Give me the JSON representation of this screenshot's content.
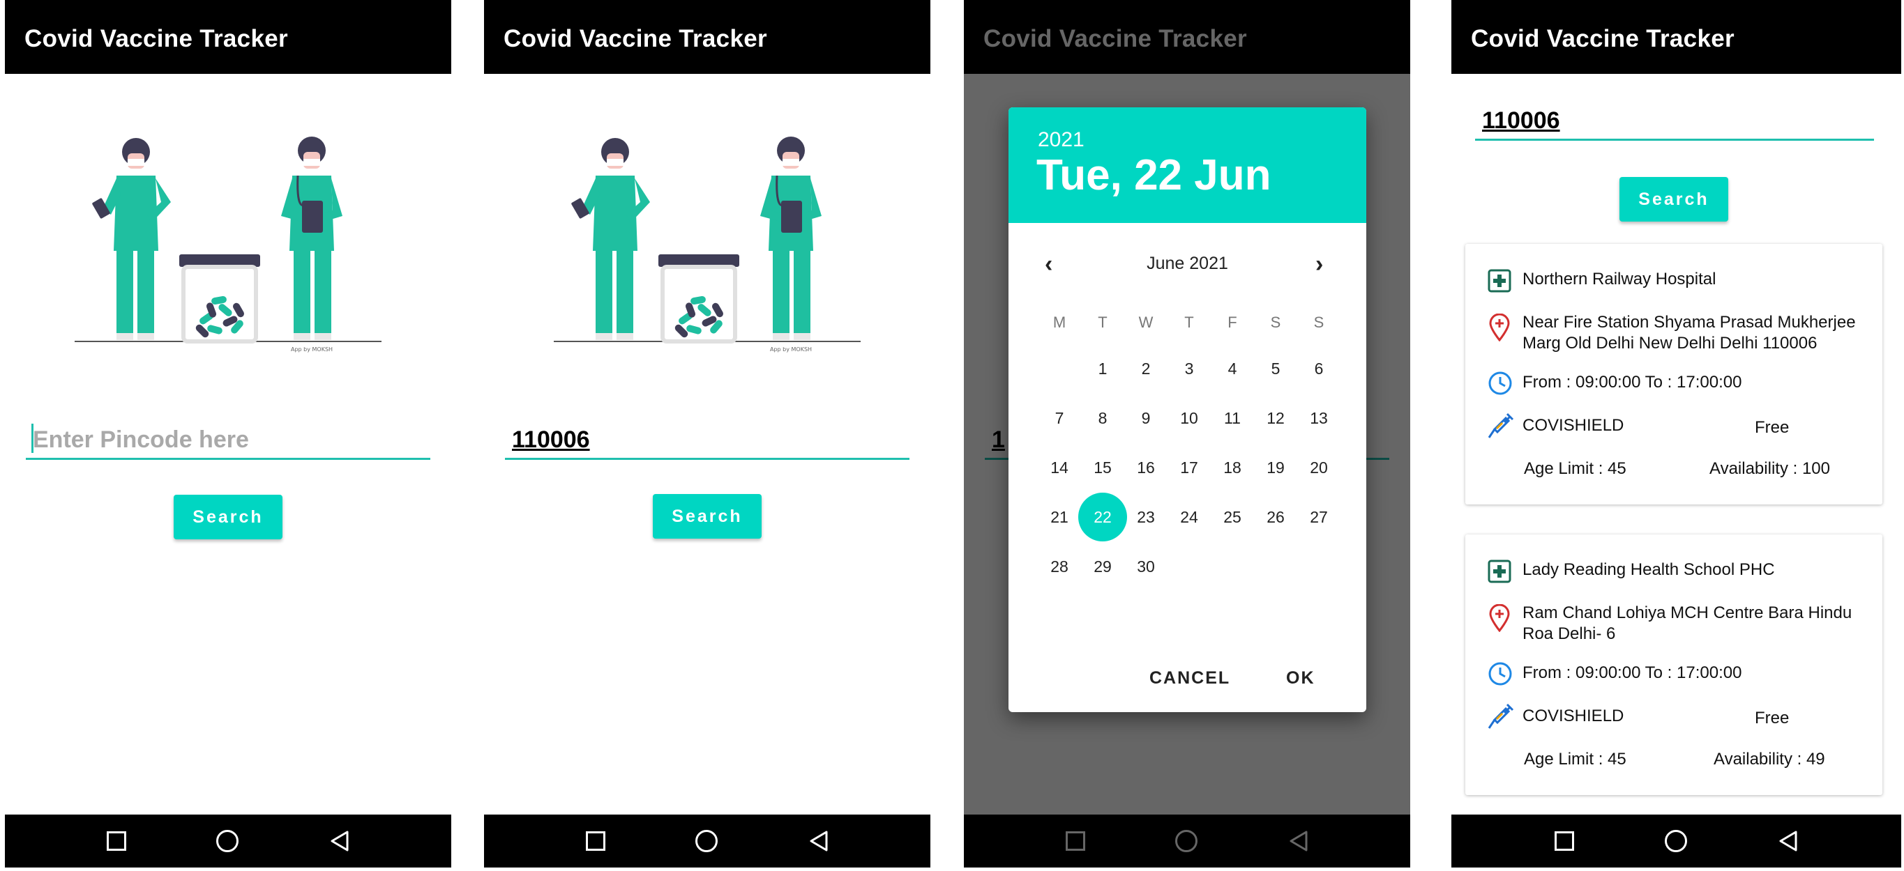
{
  "app": {
    "title": "Covid Vaccine Tracker"
  },
  "screen1": {
    "pincode_placeholder": "Enter Pincode here",
    "search_label": "Search"
  },
  "screen2": {
    "pincode_value": "110006",
    "search_label": "Search"
  },
  "screen3": {
    "dialog": {
      "year": "2021",
      "selected_date": "Tue, 22 Jun",
      "month_label": "June 2021",
      "weekdays": [
        "M",
        "T",
        "W",
        "T",
        "F",
        "S",
        "S"
      ],
      "days": [
        "1",
        "2",
        "3",
        "4",
        "5",
        "6",
        "7",
        "8",
        "9",
        "10",
        "11",
        "12",
        "13",
        "14",
        "15",
        "16",
        "17",
        "18",
        "19",
        "20",
        "21",
        "22",
        "23",
        "24",
        "25",
        "26",
        "27",
        "28",
        "29",
        "30"
      ],
      "selected_day": "22",
      "cancel_label": "CANCEL",
      "ok_label": "OK"
    },
    "bg_field_partial": "1"
  },
  "screen4": {
    "pincode_value": "110006",
    "search_label": "Search",
    "centers": [
      {
        "name": "Northern Railway Hospital",
        "address": "Near Fire Station Shyama Prasad Mukherjee Marg Old Delhi New Delhi Delhi 110006",
        "timing": "From : 09:00:00 To : 17:00:00",
        "vaccine": "COVISHIELD",
        "fee": "Free",
        "age_limit": "Age Limit : 45",
        "availability": "Availability : 100"
      },
      {
        "name": "Lady Reading Health School PHC",
        "address": "Ram Chand Lohiya MCH Centre Bara Hindu Roa Delhi- 6",
        "timing": "From : 09:00:00 To : 17:00:00",
        "vaccine": "COVISHIELD",
        "fee": "Free",
        "age_limit": "Age Limit : 45",
        "availability": "Availability : 49"
      }
    ]
  },
  "illustration": {
    "credit": "App by MOKSH"
  },
  "colors": {
    "accent": "#00d6c2",
    "underline": "#1fbfae",
    "appbar": "#000000",
    "hospital_icon": "#1a6b55",
    "location_icon": "#d32f2f",
    "clock_icon": "#1e88e5",
    "syringe_icon": "#1e6fd1"
  },
  "icons": {
    "hospital": "hospital-plus-icon",
    "location": "location-pin-icon",
    "clock": "clock-icon",
    "vaccine": "syringe-icon",
    "nav_recents": "square-icon",
    "nav_home": "circle-icon",
    "nav_back": "triangle-back-icon"
  }
}
